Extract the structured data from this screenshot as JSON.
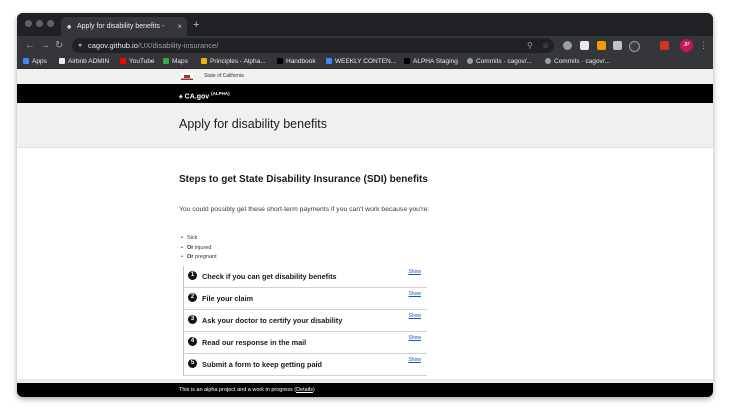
{
  "tab": {
    "title": "Apply for disability benefits - ",
    "close": "×",
    "new_tab": "+"
  },
  "omnibox": {
    "host": "cagov.github.io",
    "path": "/UX/disability-insurance/"
  },
  "bookmarks": [
    {
      "label": "Apps",
      "color": "#4285f4"
    },
    {
      "label": "Airbnb ADMIN",
      "color": "#e8eaed"
    },
    {
      "label": "YouTube",
      "color": "#ff0000"
    },
    {
      "label": "Maps",
      "color": "#34a853"
    },
    {
      "label": "Principles - Alpha...",
      "color": "#f4b400"
    },
    {
      "label": "Handbook",
      "color": "#202124"
    },
    {
      "label": "WEEKLY CONTEN...",
      "color": "#4285f4"
    },
    {
      "label": "ALPHA Staging",
      "color": "#202124"
    },
    {
      "label": "Commits · cagov/...",
      "color": "#9aa0a6"
    },
    {
      "label": "Commits · cagov/...",
      "color": "#9aa0a6"
    }
  ],
  "profile_initials": "JP",
  "site": {
    "state_label": "State of California",
    "logo_text": "CA.gov",
    "logo_sup": "(ALPHA)",
    "page_title": "Apply for disability benefits",
    "heading": "Steps to get State Disability Insurance (SDI) benefits",
    "intro": "You could possibly get these short-term payments if you can't work because you're:",
    "conditions": [
      {
        "prefix": "",
        "text": "Sick"
      },
      {
        "prefix": "Or",
        "text": " injured"
      },
      {
        "prefix": "Or",
        "text": " pregnant"
      }
    ],
    "steps": [
      {
        "num": "1",
        "label": "Check if you can get disability benefits",
        "action": "Show"
      },
      {
        "num": "2",
        "label": "File your claim",
        "action": "Show"
      },
      {
        "num": "3",
        "label": "Ask your doctor to certify your disability",
        "action": "Show"
      },
      {
        "num": "4",
        "label": "Read our response in the mail",
        "action": "Show"
      },
      {
        "num": "5",
        "label": "Submit a form to keep getting paid",
        "action": "Show"
      }
    ],
    "footer": {
      "text": "This is an alpha project and a work in progress (",
      "link": "Details",
      "suffix": ")"
    }
  },
  "colors": {
    "accent_link": "#1a55c4",
    "chrome_dark": "#202124",
    "chrome_mid": "#35363a"
  }
}
